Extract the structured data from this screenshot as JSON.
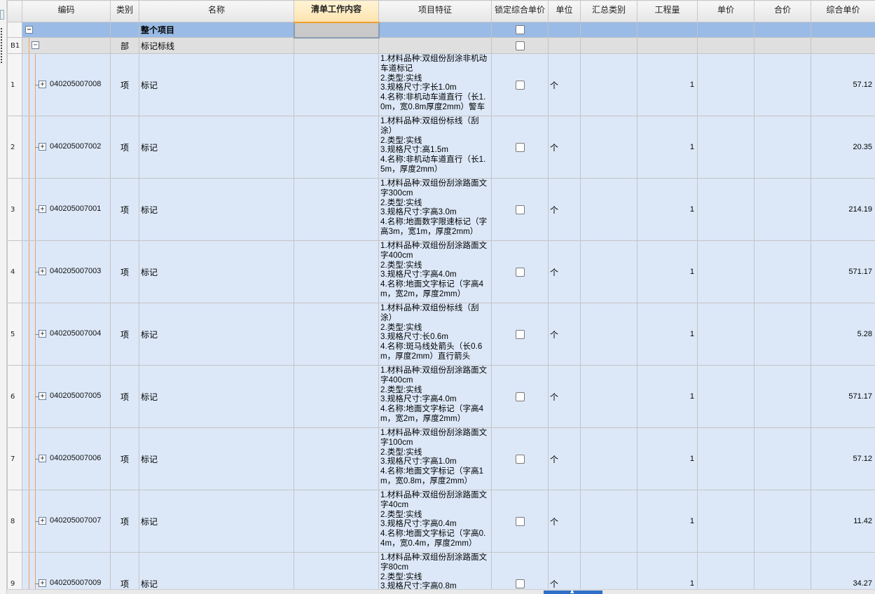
{
  "columns": [
    {
      "key": "code",
      "label": "编码"
    },
    {
      "key": "category",
      "label": "类别"
    },
    {
      "key": "name",
      "label": "名称"
    },
    {
      "key": "work",
      "label": "清单工作内容",
      "active": true
    },
    {
      "key": "feature",
      "label": "项目特征"
    },
    {
      "key": "lock",
      "label": "锁定综合单价"
    },
    {
      "key": "unit",
      "label": "单位"
    },
    {
      "key": "summary",
      "label": "汇总类别"
    },
    {
      "key": "quantity",
      "label": "工程量"
    },
    {
      "key": "unit_price",
      "label": "单价"
    },
    {
      "key": "total_price",
      "label": "合价"
    },
    {
      "key": "composite_price",
      "label": "综合单价"
    }
  ],
  "whole_row": {
    "label": "整个项目",
    "collapse_symbol": "−"
  },
  "part_row": {
    "row_label": "B1",
    "category": "部",
    "name": "标记标线",
    "collapse_symbol": "−"
  },
  "items": [
    {
      "row": "1",
      "code": "040205007008",
      "category": "项",
      "name": "标记",
      "feature": [
        "1.材料品种:双组份刮涂非机动车道标记",
        "2.类型:实线",
        "3.规格尺寸:字长1.0m",
        "4.名称:非机动车道直行（长1.0m，宽0.8m厚度2mm）警车"
      ],
      "unit": "个",
      "quantity": "1",
      "composite_price": "57.12"
    },
    {
      "row": "2",
      "code": "040205007002",
      "category": "项",
      "name": "标记",
      "feature": [
        "1.材料品种:双组份标线（刮涂）",
        "2.类型:实线",
        "3.规格尺寸:高1.5m",
        "4.名称:非机动车道直行（长1.5m，厚度2mm）"
      ],
      "unit": "个",
      "quantity": "1",
      "composite_price": "20.35"
    },
    {
      "row": "3",
      "code": "040205007001",
      "category": "项",
      "name": "标记",
      "feature": [
        "1.材料品种:双组份刮涂路面文字300cm",
        "2.类型:实线",
        "3.规格尺寸:字高3.0m",
        "4.名称:地面数字限速标记（字高3m，宽1m，厚度2mm）"
      ],
      "unit": "个",
      "quantity": "1",
      "composite_price": "214.19"
    },
    {
      "row": "4",
      "code": "040205007003",
      "category": "项",
      "name": "标记",
      "feature": [
        "1.材料品种:双组份刮涂路面文字400cm",
        "2.类型:实线",
        "3.规格尺寸:字高4.0m",
        "4.名称:地面文字标记（字高4m，宽2m，厚度2mm）"
      ],
      "unit": "个",
      "quantity": "1",
      "composite_price": "571.17"
    },
    {
      "row": "5",
      "code": "040205007004",
      "category": "项",
      "name": "标记",
      "feature": [
        "1.材料品种:双组份标线（刮涂）",
        "2.类型:实线",
        "3.规格尺寸:长0.6m",
        "4.名称:斑马线处箭头（长0.6m，厚度2mm）直行箭头"
      ],
      "unit": "个",
      "quantity": "1",
      "composite_price": "5.28"
    },
    {
      "row": "6",
      "code": "040205007005",
      "category": "项",
      "name": "标记",
      "feature": [
        "1.材料品种:双组份刮涂路面文字400cm",
        "2.类型:实线",
        "3.规格尺寸:字高4.0m",
        "4.名称:地面文字标记（字高4m，宽2m，厚度2mm）"
      ],
      "unit": "个",
      "quantity": "1",
      "composite_price": "571.17"
    },
    {
      "row": "7",
      "code": "040205007006",
      "category": "项",
      "name": "标记",
      "feature": [
        "1.材料品种:双组份刮涂路面文字100cm",
        "2.类型:实线",
        "3.规格尺寸:字高1.0m",
        "4.名称:地面文字标记（字高1m，宽0.8m，厚度2mm）"
      ],
      "unit": "个",
      "quantity": "1",
      "composite_price": "57.12"
    },
    {
      "row": "8",
      "code": "040205007007",
      "category": "项",
      "name": "标记",
      "feature": [
        "1.材料品种:双组份刮涂路面文字40cm",
        "2.类型:实线",
        "3.规格尺寸:字高0.4m",
        "4.名称:地面文字标记（字高0.4m，宽0.4m，厚度2mm）"
      ],
      "unit": "个",
      "quantity": "1",
      "composite_price": "11.42"
    },
    {
      "row": "9",
      "code": "040205007009",
      "category": "项",
      "name": "标记",
      "feature": [
        "1.材料品种:双组份刮涂路面文字80cm",
        "2.类型:实线",
        "3.规格尺寸:字高0.8m"
      ],
      "unit": "个",
      "quantity": "1",
      "composite_price": "34.27"
    }
  ],
  "expand_symbol": "+",
  "colors": {
    "header_active": "#fde3ae",
    "whole_row": "#99bbe6",
    "item_row": "#dce8f8",
    "tree_line": "#f0a060",
    "scroll_thumb": "#2f6fc8"
  }
}
